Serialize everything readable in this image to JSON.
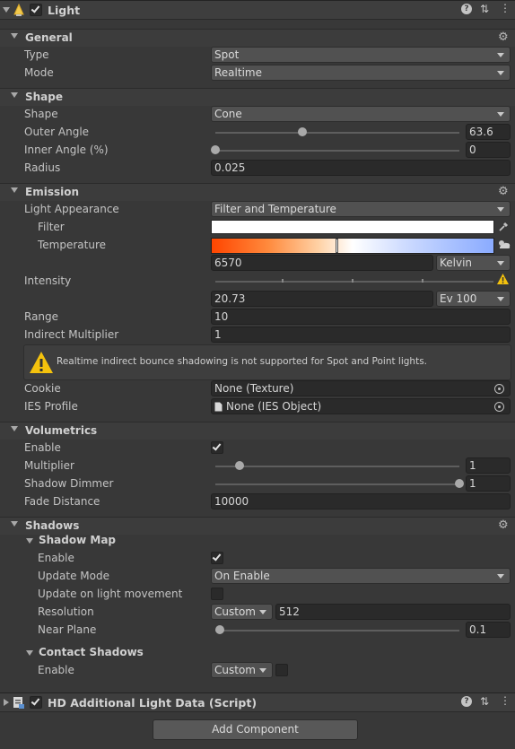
{
  "component": {
    "title": "Light",
    "icons": [
      "help-icon",
      "preset-icon",
      "more-icon"
    ]
  },
  "general": {
    "title": "General",
    "type_label": "Type",
    "type_value": "Spot",
    "mode_label": "Mode",
    "mode_value": "Realtime"
  },
  "shape": {
    "title": "Shape",
    "shape_label": "Shape",
    "shape_value": "Cone",
    "outer_angle_label": "Outer Angle",
    "outer_angle_value": "63.6",
    "outer_angle_fraction": 0.355,
    "inner_angle_label": "Inner Angle (%)",
    "inner_angle_value": "0",
    "inner_angle_fraction": 0,
    "radius_label": "Radius",
    "radius_value": "0.025"
  },
  "emission": {
    "title": "Emission",
    "appearance_label": "Light Appearance",
    "appearance_value": "Filter and Temperature",
    "filter_label": "Filter",
    "filter_color": "#ffffff",
    "temperature_label": "Temperature",
    "temperature_value": "6570",
    "temperature_unit": "Kelvin",
    "intensity_label": "Intensity",
    "intensity_value": "20.73",
    "intensity_unit": "Ev 100",
    "range_label": "Range",
    "range_value": "10",
    "indirect_label": "Indirect Multiplier",
    "indirect_value": "1",
    "warning_text": "Realtime indirect bounce shadowing is not supported for Spot and Point lights.",
    "cookie_label": "Cookie",
    "cookie_value": "None (Texture)",
    "ies_label": "IES Profile",
    "ies_value": "None (IES Object)"
  },
  "volumetrics": {
    "title": "Volumetrics",
    "enable_label": "Enable",
    "enable_checked": true,
    "multiplier_label": "Multiplier",
    "multiplier_value": "1",
    "multiplier_fraction": 0.1,
    "dimmer_label": "Shadow Dimmer",
    "dimmer_value": "1",
    "dimmer_fraction": 1,
    "fade_label": "Fade Distance",
    "fade_value": "10000"
  },
  "shadows": {
    "title": "Shadows",
    "shadow_map_title": "Shadow Map",
    "enable_label": "Enable",
    "enable_checked": true,
    "update_mode_label": "Update Mode",
    "update_mode_value": "On Enable",
    "update_movement_label": "Update on light movement",
    "update_movement_checked": false,
    "resolution_label": "Resolution",
    "resolution_mode": "Custom",
    "resolution_value": "512",
    "near_plane_label": "Near Plane",
    "near_plane_value": "0.1",
    "near_plane_fraction": 0.02,
    "contact_title": "Contact Shadows",
    "contact_enable_label": "Enable",
    "contact_mode": "Custom",
    "contact_checked": false
  },
  "additional": {
    "title": "HD Additional Light Data (Script)"
  },
  "add_component_label": "Add Component",
  "colors": {
    "background": "#383838",
    "field": "#2a2a2a",
    "warning": "#f4c20d",
    "temperature_gradient": [
      "#ff4500",
      "#ffffff",
      "#8aabff"
    ]
  }
}
